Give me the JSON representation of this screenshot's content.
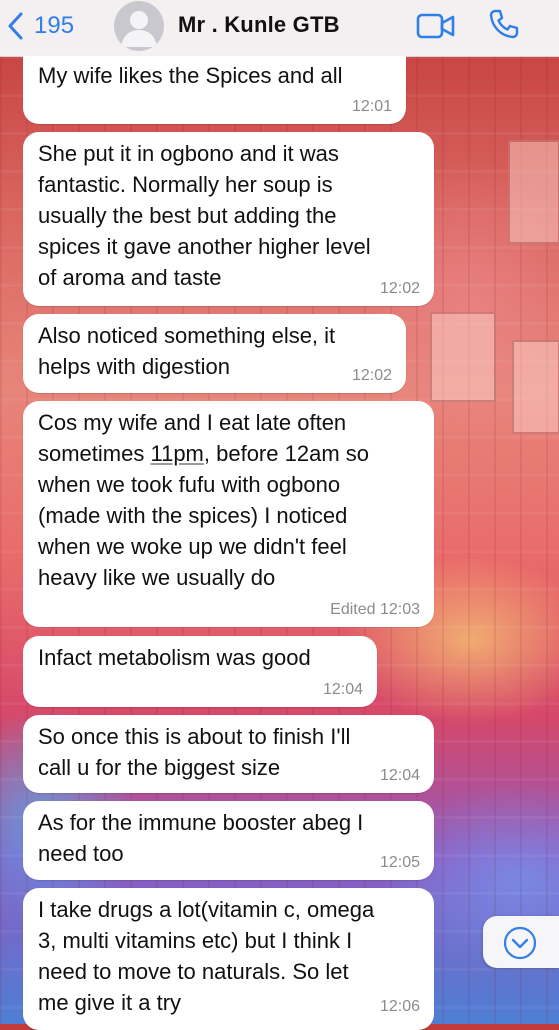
{
  "header": {
    "back_count": "195",
    "contact_name": "Mr . Kunle GTB",
    "video_icon": "video-camera-icon",
    "call_icon": "phone-icon"
  },
  "colors": {
    "accent": "#2f7fe8",
    "bubble": "#ffffff",
    "time": "#8b8b90"
  },
  "messages": [
    {
      "text": "My wife likes the Spices and all",
      "time": "12:01"
    },
    {
      "text": "She put it in ogbono and it was\nfantastic. Normally her soup is\nusually the best but adding the\nspices it gave another higher level\nof aroma and taste",
      "time": "12:02"
    },
    {
      "text": "Also noticed something else, it\nhelps with digestion",
      "time": "12:02"
    },
    {
      "text_before": "Cos my wife and I eat late often\nsometimes ",
      "text_link": "11pm",
      "text_after": ", before 12am so\nwhen we took fufu with ogbono\n(made with the spices) I noticed\nwhen we woke up we didn't feel\nheavy like we usually do",
      "time": "Edited 12:03"
    },
    {
      "text": "Infact metabolism was good",
      "time": "12:04"
    },
    {
      "text": "So once this is about to finish I'll\ncall u for the biggest size",
      "time": "12:04"
    },
    {
      "text": "As for the immune booster abeg I\nneed too",
      "time": "12:05"
    },
    {
      "text": "I take drugs a lot(vitamin c, omega\n3, multi vitamins etc) but I think I\nneed to move to naturals. So let\nme give it a try",
      "time": "12:06"
    }
  ],
  "scroll_button_icon": "chevron-down-circle-icon"
}
